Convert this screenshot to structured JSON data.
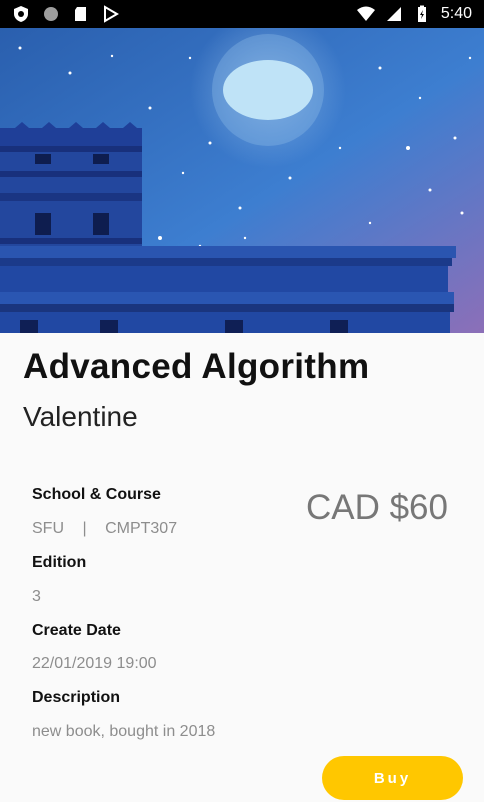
{
  "status_bar": {
    "time": "5:40",
    "icons": [
      "shield-icon",
      "circle-icon",
      "sd-card-icon",
      "play-store-icon",
      "wifi-icon",
      "signal-icon",
      "battery-charging-icon"
    ]
  },
  "hero": {
    "image": "book-cover-night-castle-illustration"
  },
  "book": {
    "title": "Advanced Algorithm",
    "author": "Valentine",
    "price": "CAD $60"
  },
  "details": {
    "school_course_label": "School & Course",
    "school": "SFU",
    "separator": "|",
    "course": "CMPT307",
    "edition_label": "Edition",
    "edition": "3",
    "create_date_label": "Create Date",
    "create_date": "22/01/2019 19:00",
    "description_label": "Description",
    "description": "new book, bought in 2018"
  },
  "actions": {
    "buy_label": "Buy"
  },
  "colors": {
    "accent": "#ffc700",
    "sky_top": "#2a66b8",
    "sky_bottom": "#8c6fb8",
    "castle": "#1e3f96"
  }
}
